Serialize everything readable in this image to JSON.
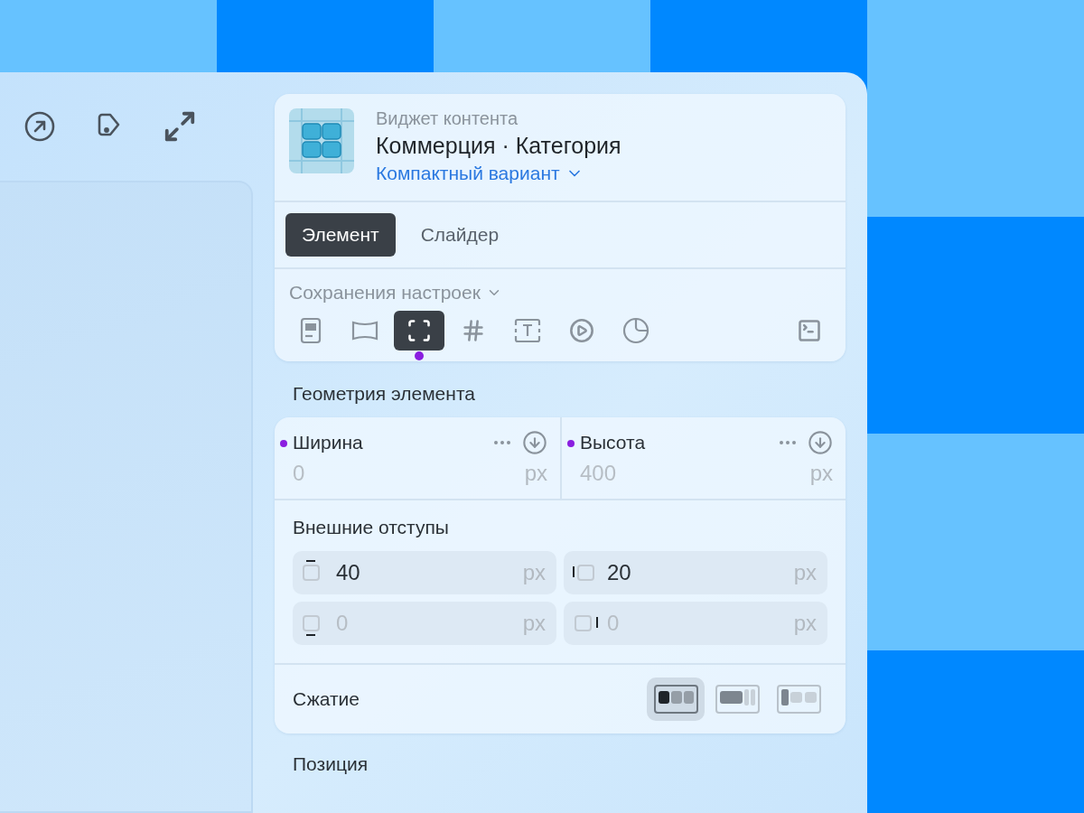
{
  "widget": {
    "caption": "Виджет контента",
    "title": "Коммерция · Категория",
    "variant": "Компактный вариант"
  },
  "tabs": [
    {
      "label": "Элемент",
      "selected": true
    },
    {
      "label": "Слайдер",
      "selected": false
    }
  ],
  "presets": {
    "label": "Сохранения настроек"
  },
  "tools": [
    {
      "kind": "card",
      "selected": false
    },
    {
      "kind": "banner",
      "selected": false
    },
    {
      "kind": "frame",
      "selected": true
    },
    {
      "kind": "grid",
      "selected": false
    },
    {
      "kind": "text",
      "selected": false
    },
    {
      "kind": "video",
      "selected": false
    },
    {
      "kind": "sticker",
      "selected": false
    },
    {
      "kind": "code",
      "selected": false
    }
  ],
  "geometry": {
    "title": "Геометрия элемента",
    "fields": [
      {
        "label": "Ширина",
        "placeholder": "0",
        "unit": "px",
        "modified": true
      },
      {
        "label": "Высота",
        "placeholder": "400",
        "unit": "px",
        "modified": true
      }
    ]
  },
  "margins": {
    "title": "Внешние отступы",
    "fields": [
      {
        "kind": "top",
        "value": "40",
        "unit": "px"
      },
      {
        "kind": "left",
        "value": "20",
        "unit": "px"
      },
      {
        "kind": "bottom",
        "placeholder": "0",
        "unit": "px"
      },
      {
        "kind": "right",
        "placeholder": "0",
        "unit": "px"
      }
    ]
  },
  "compression": {
    "label": "Сжатие",
    "options": [
      {
        "kind": "spread",
        "selected": true
      },
      {
        "kind": "shrink-rest",
        "selected": false
      },
      {
        "kind": "fixed-first",
        "selected": false
      }
    ]
  },
  "position": {
    "title": "Позиция"
  }
}
